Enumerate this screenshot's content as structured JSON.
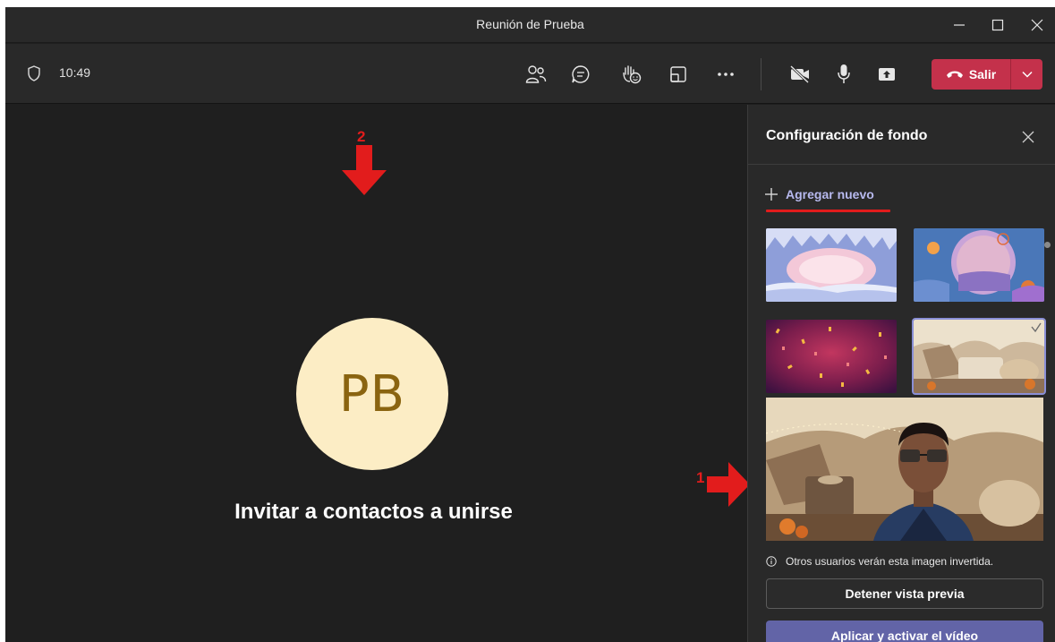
{
  "window": {
    "title": "Reunión de Prueba"
  },
  "toolbar": {
    "time": "10:49",
    "icons": [
      "participants-icon",
      "chat-icon",
      "raise-hand-icon",
      "rooms-icon",
      "more-icon",
      "camera-off-icon",
      "microphone-icon",
      "share-icon"
    ],
    "leave_label": "Salir",
    "leave_color": "#c4314b"
  },
  "stage": {
    "avatar_initials": "PB",
    "avatar_bg": "#fcedc5",
    "avatar_fg": "#8a6410",
    "invite_text": "Invitar a contactos a unirse"
  },
  "annotations": {
    "arrow_1": "1",
    "arrow_2": "2",
    "color": "#e21c1c"
  },
  "panel": {
    "title": "Configuración de fondo",
    "add_new_label": "Agregar nuevo",
    "backgrounds": [
      {
        "name": "ice-cave",
        "selected": false
      },
      {
        "name": "autumn-window",
        "selected": false
      },
      {
        "name": "confetti",
        "selected": false
      },
      {
        "name": "blanket-fort",
        "selected": true
      }
    ],
    "info_text": "Otros usuarios verán esta imagen invertida.",
    "stop_preview_label": "Detener vista previa",
    "apply_label": "Aplicar y activar el vídeo",
    "accent": "#6264a7"
  }
}
